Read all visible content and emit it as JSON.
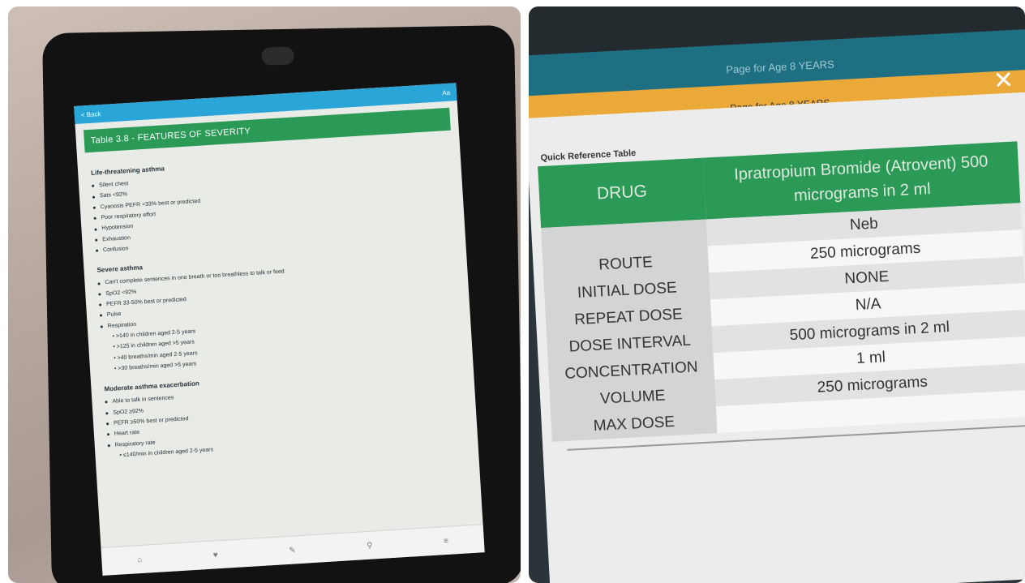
{
  "left_photo": {
    "app": {
      "nav_back": "< Back",
      "title": "",
      "text_size_button": "Aa",
      "section_title": "Table 3.8 - FEATURES OF SEVERITY",
      "groups": [
        {
          "heading": "Life-threatening asthma",
          "items": [
            "Silent chest",
            "Sats <92%",
            "Cyanosis PEFR <33% best or predicted",
            "Poor respiratory effort",
            "Hypotension",
            "Exhaustion",
            "Confusion"
          ]
        },
        {
          "heading": "Severe asthma",
          "items": [
            "Can't complete sentences in one breath or too breathless to talk or feed",
            "SpO2 <92%",
            "PEFR 33-50% best or predicted",
            "Pulse",
            "Respiration"
          ],
          "sub": [
            "• >140 in children aged 2-5 years",
            "• >125 in children aged >5 years",
            "• >40 breaths/min aged 2-5 years",
            "• >30 breaths/min aged >5 years"
          ]
        },
        {
          "heading": "Moderate asthma exacerbation",
          "items": [
            "Able to talk in sentences",
            "SpO2 ≥92%",
            "PEFR ≥50% best or predicted",
            "Heart rate",
            "Respiratory rate"
          ],
          "sub": [
            "• ≤140/min in children aged 2-5 years"
          ]
        }
      ],
      "tabs": [
        "⌂",
        "♥",
        "✎",
        "⚲",
        "≡"
      ]
    }
  },
  "right_photo": {
    "teal_bar": "Page for Age 8 YEARS",
    "orange_bar": "Page for Age 8 YEARS",
    "close_glyph": "✕",
    "table_caption": "Quick Reference Table",
    "drug_header": "DRUG",
    "drug_value": "Ipratropium Bromide (Atrovent) 500 micrograms in 2 ml",
    "rows": [
      {
        "label": "",
        "value": "Neb"
      },
      {
        "label": "ROUTE",
        "value": "250 micrograms"
      },
      {
        "label": "INITIAL DOSE",
        "value": "NONE"
      },
      {
        "label": "REPEAT DOSE",
        "value": "N/A"
      },
      {
        "label": "DOSE INTERVAL",
        "value": "500 micrograms in 2 ml"
      },
      {
        "label": "CONCENTRATION",
        "value": "1 ml"
      },
      {
        "label": "VOLUME",
        "value": "250 micrograms"
      },
      {
        "label": "MAX DOSE",
        "value": ""
      }
    ]
  }
}
